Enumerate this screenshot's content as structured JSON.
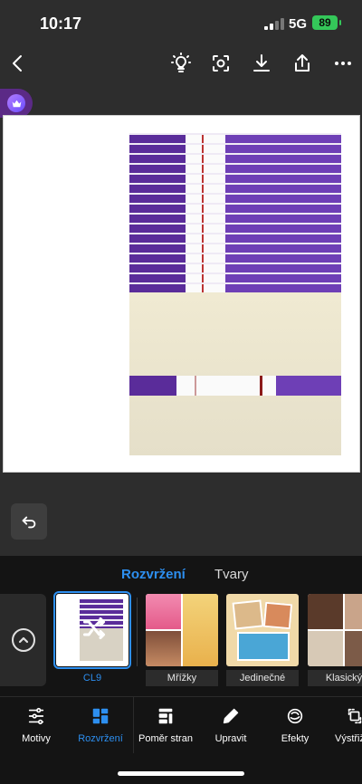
{
  "status_bar": {
    "time": "10:17",
    "network": "5G",
    "battery": "89"
  },
  "toolbar": {
    "back_icon": "chevron-left-icon",
    "tips_icon": "lightbulb-icon",
    "focus_icon": "scan-icon",
    "download_icon": "download-icon",
    "share_icon": "share-icon",
    "more_icon": "more-icon"
  },
  "premium": {
    "icon": "crown-icon",
    "accent": "#5b2a86"
  },
  "panel": {
    "tabs": [
      {
        "label": "Rozvržení",
        "active": true
      },
      {
        "label": "Tvary",
        "active": false
      }
    ],
    "layouts": [
      {
        "label": "CL9",
        "selected": true
      },
      {
        "label": "Mřížky",
        "selected": false
      },
      {
        "label": "Jedinečné",
        "selected": false
      },
      {
        "label": "Klasický",
        "selected": false
      }
    ]
  },
  "nav": {
    "items": [
      {
        "label": "Motivy",
        "icon": "settings-sliders-icon"
      },
      {
        "label": "Rozvržení",
        "icon": "layout-icon",
        "active": true
      },
      {
        "label": "Poměr stran",
        "icon": "aspect-ratio-icon"
      },
      {
        "label": "Upravit",
        "icon": "pencil-icon"
      },
      {
        "label": "Efekty",
        "icon": "effects-icon"
      },
      {
        "label": "Výstřižky",
        "icon": "cutout-icon"
      }
    ]
  },
  "colors": {
    "accent": "#2d8ff0",
    "battery": "#34c759",
    "panel_bg": "#141414"
  }
}
